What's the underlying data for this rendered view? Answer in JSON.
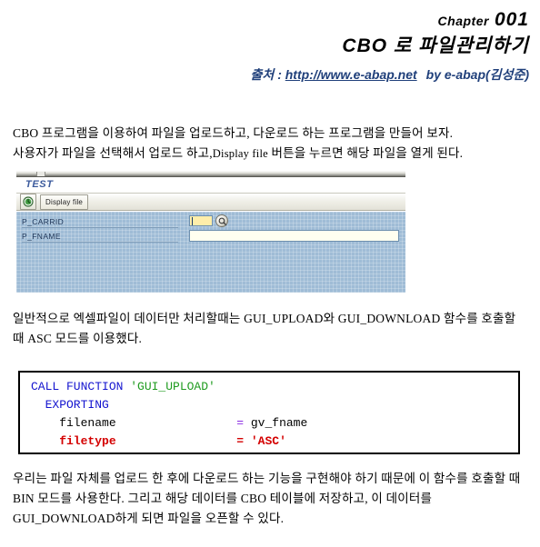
{
  "header": {
    "chapter_word": "Chapter",
    "chapter_number": "001",
    "title": "CBO 로  파일관리하기",
    "source_label": "출처 : ",
    "source_url": "http://www.e-abap.net",
    "source_by": "by e-abap(김성준)"
  },
  "body": {
    "intro_line1": "CBO 프로그램을 이용하여 파일을 업로드하고, 다운로드 하는 프로그램을 만들어 보자.",
    "intro_line2_a": "사용자가 파일을 선택해서 업로드 하고,",
    "intro_line2_b": "Display file",
    "intro_line2_c": "버튼을 누르면 해당 파일을 열게 된다.",
    "mid_paragraph": "일반적으로 엑셀파일이 데이터만 처리할때는 GUI_UPLOAD와 GUI_DOWNLOAD 함수를 호출할 때 ASC 모드를 이용했다.",
    "end_paragraph": "우리는 파일 자체를 업로드 한 후에 다운로드 하는 기능을 구현해야 하기 때문에 이 함수를 호출할 때 BIN 모드를 사용한다. 그리고 해당 데이터를 CBO 테이블에 저장하고, 이 데이터를 GUI_DOWNLOAD하게 되면 파일을 오픈할 수 있다."
  },
  "sap": {
    "screen_title": "TEST",
    "toolbar": {
      "execute_icon": "execute-clock-icon",
      "display_file_label": "Display file"
    },
    "fields": [
      {
        "label": "P_CARRID",
        "value": "",
        "type": "short-with-f4",
        "f4_icon": "search-help-icon"
      },
      {
        "label": "P_FNAME",
        "value": "",
        "type": "long"
      }
    ]
  },
  "code": {
    "line1_kw": "CALL FUNCTION ",
    "line1_str": "'GUI_UPLOAD'",
    "line2_kw": "  EXPORTING",
    "line3_name": "    filename",
    "line3_pad": "                 ",
    "line3_op": "= ",
    "line3_val": "gv_fname",
    "line4_name": "    filetype",
    "line4_pad": "                 ",
    "line4_op": "= ",
    "line4_val": "'ASC'"
  },
  "colors": {
    "header_blue": "#1f3f7a",
    "sap_title_blue": "#3b5a9c",
    "selscreen_blue": "#9fbcd6",
    "field_yellow": "#ffeeaa",
    "code_keyword": "#1414cf",
    "code_string": "#1f9b1f",
    "code_operator": "#8a2be2",
    "code_highlight": "#d40000"
  }
}
